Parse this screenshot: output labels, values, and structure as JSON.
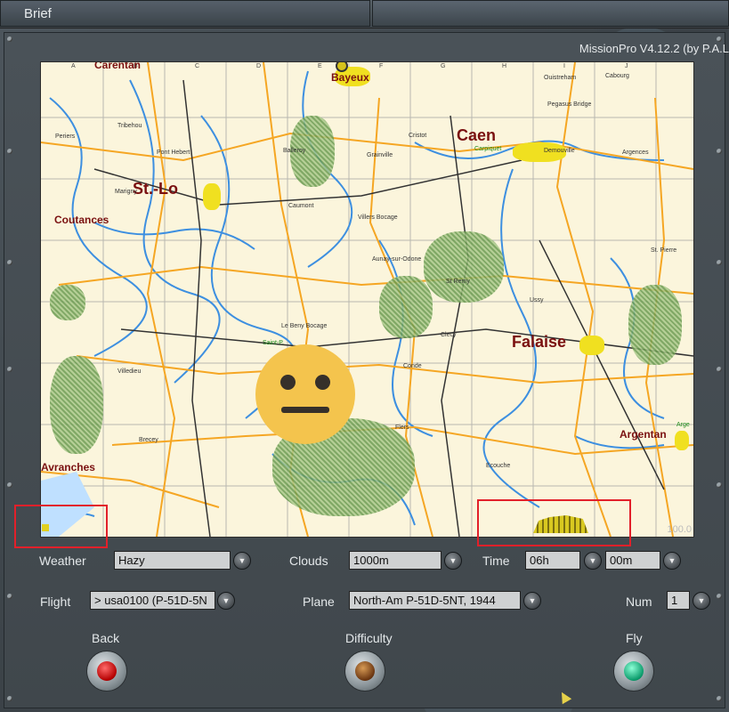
{
  "tabs": {
    "brief_label": "Brief"
  },
  "app_version": "MissionPro V4.12.2 (by P.A.L",
  "map": {
    "column_labels": [
      "A",
      "B",
      "C",
      "D",
      "E",
      "F",
      "G",
      "H",
      "I",
      "J"
    ],
    "cities": {
      "caen": "Caen",
      "stlo": "St.-Lo",
      "falaise": "Falaise",
      "bayeux": "Bayeux",
      "coutances": "Coutances",
      "argentan": "Argentan",
      "avranches": "Avranches",
      "carentan": "Carentan"
    },
    "towns": {
      "ouistreham": "Ouistreham",
      "cabourg": "Cabourg",
      "pegasus": "Pegasus Bridge",
      "periers": "Periers",
      "tribehou": "Tribehou",
      "pont_hebert": "Pont Hebert",
      "balleroy": "Balleroy",
      "grainville": "Grainville",
      "cristot": "Cristot",
      "carpiquet": "Carpiquet",
      "demouville": "Demouville",
      "argences": "Argences",
      "marigny": "Marigny",
      "caumont": "Caumont",
      "villers": "Villers Bocage",
      "aunay": "Aunay-sur-Odone",
      "st_remy": "St Remy",
      "st_pierre": "St. Pierre",
      "ussy": "Ussy",
      "le_beny": "Le Beny Bocage",
      "saint_p": "Saint-P.",
      "clecy": "Clecy",
      "villedieu": "Villedieu",
      "conde": "Conde",
      "flers": "Flers",
      "brecey": "Brecey",
      "ecouche": "Ecouche",
      "arge": "Arge"
    },
    "zoom_label": "100.0"
  },
  "controls": {
    "weather": {
      "label": "Weather",
      "value": "Hazy"
    },
    "clouds": {
      "label": "Clouds",
      "value": "1000m"
    },
    "time": {
      "label": "Time",
      "hours": "06h",
      "minutes": "00m"
    },
    "flight": {
      "label": "Flight",
      "value": "> usa0100 (P-51D-5N"
    },
    "plane": {
      "label": "Plane",
      "value": "North-Am P-51D-5NT, 1944"
    },
    "num": {
      "label": "Num",
      "value": "1"
    }
  },
  "buttons": {
    "back": "Back",
    "difficulty": "Difficulty",
    "fly": "Fly"
  },
  "colors": {
    "map_background": "#fbf5dc",
    "roads": "#f5a623",
    "rivers": "#3d8fe0",
    "city_label": "#7a1010",
    "red_highlight": "#e2202a"
  }
}
